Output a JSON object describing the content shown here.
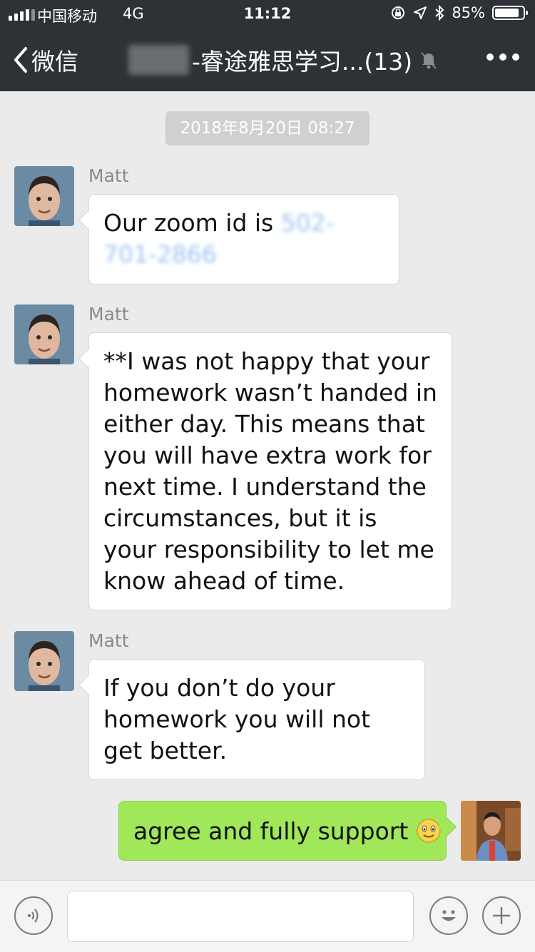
{
  "status_bar": {
    "carrier": "中国移动",
    "network": "4G",
    "time": "11:12",
    "battery": "85%"
  },
  "nav": {
    "back_label": "微信",
    "title": "-睿途雅思学习...(13)"
  },
  "timestamp": "2018年8月20日 08:27",
  "messages": [
    {
      "sender": "Matt",
      "text": "Our zoom id is ",
      "redacted": "502-701-2866"
    },
    {
      "sender": "Matt",
      "text": "**I was not happy that your homework wasn’t handed in either day. This means that you will have extra work for next time. I understand the circumstances, but it is your responsibility to let me know ahead of time."
    },
    {
      "sender": "Matt",
      "text": "If you don’t do your homework you will not get better."
    },
    {
      "sender": "me",
      "text": "agree and fully support"
    }
  ],
  "colors": {
    "nav_bg": "#2e3135",
    "chat_bg": "#ebebeb",
    "my_bubble": "#a0e75a"
  },
  "icons": [
    "back-chevron-icon",
    "mute-bell-icon",
    "more-icon",
    "voice-icon",
    "emoji-icon",
    "plus-icon",
    "smile-emoji-icon"
  ]
}
